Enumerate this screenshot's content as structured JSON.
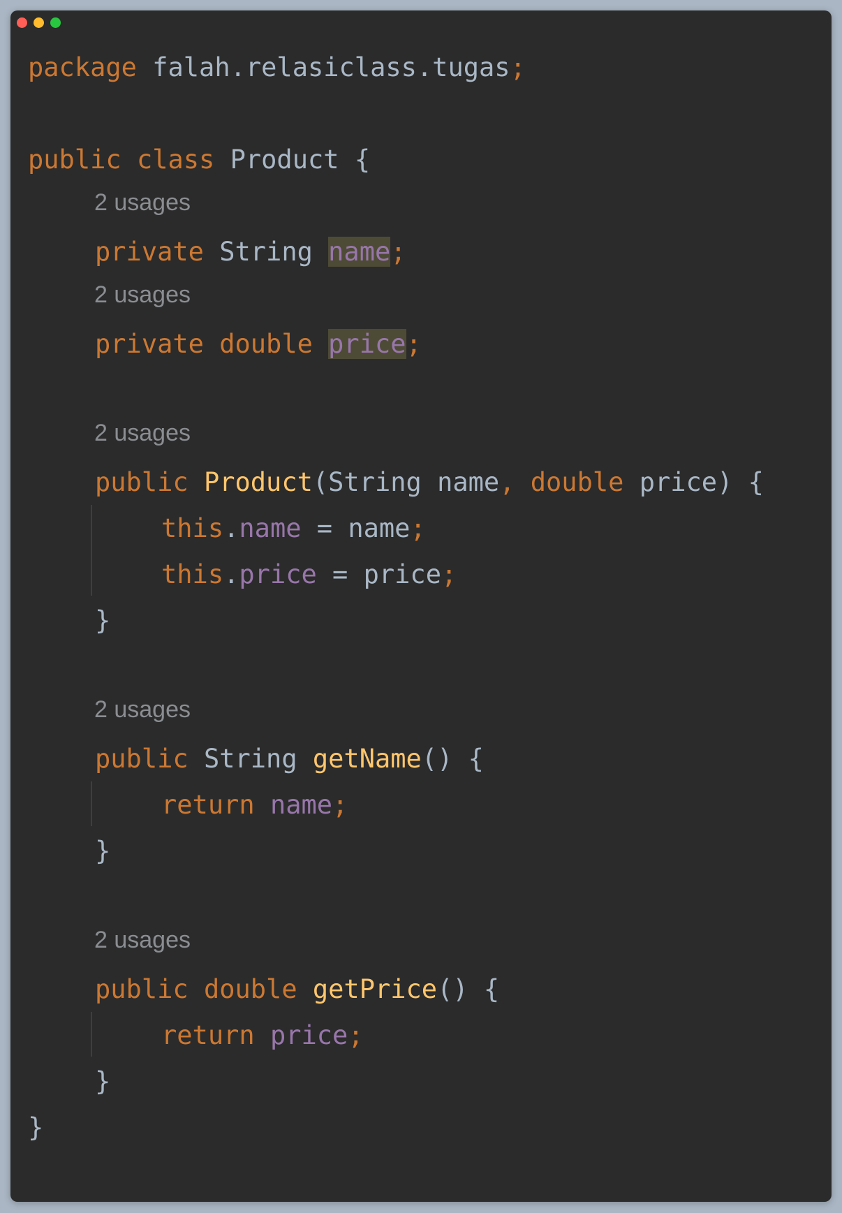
{
  "window": {
    "traffic_lights": {
      "close_color": "#ff5f57",
      "minimize_color": "#febc2e",
      "zoom_color": "#28c840"
    }
  },
  "editor": {
    "lang": "Java",
    "colors": {
      "background": "#2b2b2b",
      "keyword": "#cc7832",
      "field": "#9876aa",
      "function": "#ffc66d",
      "identifier": "#a9b7c6",
      "hint": "#8a8d91"
    },
    "code": {
      "l1": {
        "kw": "package",
        "name": "falah.relasiclass.tugas",
        "semi": ";"
      },
      "l2": {
        "kw1": "public",
        "kw2": "class",
        "name": "Product",
        "brace": "{"
      },
      "h1": "2 usages",
      "l3": {
        "kw": "private",
        "type": "String",
        "field": "name",
        "semi": ";"
      },
      "h2": "2 usages",
      "l4": {
        "kw": "private",
        "type": "double",
        "field": "price",
        "semi": ";"
      },
      "h3": "2 usages",
      "l5": {
        "kw": "public",
        "ctor": "Product",
        "p1open": "(String name",
        "comma": ",",
        "ptype": "double",
        "p2": "price) {"
      },
      "l6": {
        "kw": "this",
        "dot": ".",
        "field": "name",
        "rest": " = name",
        "semi": ";"
      },
      "l7": {
        "kw": "this",
        "dot": ".",
        "field": "price",
        "rest": " = price",
        "semi": ";"
      },
      "l8": "}",
      "h4": "2 usages",
      "l9": {
        "kw": "public",
        "type": "String",
        "fn": "getName",
        "rest": "() {"
      },
      "l10": {
        "kw": "return",
        "field": "name",
        "semi": ";"
      },
      "l11": "}",
      "h5": "2 usages",
      "l12": {
        "kw": "public",
        "type": "double",
        "fn": "getPrice",
        "rest": "() {"
      },
      "l13": {
        "kw": "return",
        "field": "price",
        "semi": ";"
      },
      "l14": "}",
      "l15": "}"
    }
  }
}
